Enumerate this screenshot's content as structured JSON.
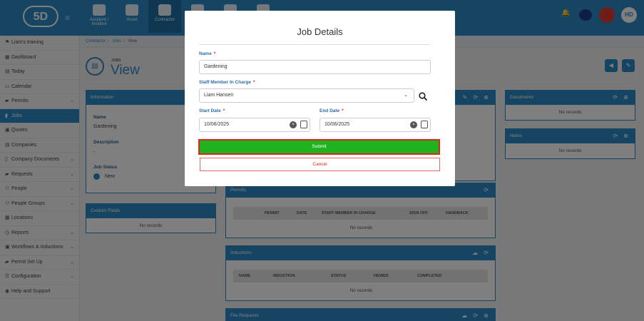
{
  "topbar": {
    "logo": "5D",
    "nav": [
      {
        "label": "Accident / Incident",
        "icon": "first-aid-kit-icon"
      },
      {
        "label": "Asset",
        "icon": "boxes-icon"
      },
      {
        "label": "Contractor",
        "icon": "hard-hat-icon"
      },
      {
        "label": "",
        "icon": "document-icon"
      },
      {
        "label": "",
        "icon": "person-icon"
      },
      {
        "label": "",
        "icon": "database-icon"
      }
    ],
    "user_initials": "HD"
  },
  "sidebar": {
    "items": [
      {
        "label": "Liam's training",
        "icon": "flag-icon",
        "chevron": false
      },
      {
        "label": "Dashboard",
        "icon": "dashboard-icon",
        "chevron": false
      },
      {
        "label": "Today",
        "icon": "calendar-today-icon",
        "chevron": false
      },
      {
        "label": "Calendar",
        "icon": "calendar-icon",
        "chevron": false
      },
      {
        "label": "Permits",
        "icon": "permit-icon",
        "chevron": true
      },
      {
        "label": "Jobs",
        "icon": "clipboard-icon",
        "chevron": false,
        "active": true
      },
      {
        "label": "Quotes",
        "icon": "quote-icon",
        "chevron": false
      },
      {
        "label": "Companies",
        "icon": "building-icon",
        "chevron": false
      },
      {
        "label": "Company Documents",
        "icon": "document-icon",
        "chevron": true
      },
      {
        "label": "Requests",
        "icon": "requests-icon",
        "chevron": true
      },
      {
        "label": "People",
        "icon": "people-icon",
        "chevron": true
      },
      {
        "label": "People Groups",
        "icon": "people-groups-icon",
        "chevron": true
      },
      {
        "label": "Locations",
        "icon": "locations-icon",
        "chevron": false
      },
      {
        "label": "Reports",
        "icon": "reports-icon",
        "chevron": true
      },
      {
        "label": "Workflows & Inductions",
        "icon": "workflow-icon",
        "chevron": true
      },
      {
        "label": "Permit Set Up",
        "icon": "permit-setup-icon",
        "chevron": true
      },
      {
        "label": "Configuration",
        "icon": "configuration-icon",
        "chevron": true
      },
      {
        "label": "Help and Support",
        "icon": "help-icon",
        "chevron": false
      }
    ]
  },
  "breadcrumb": {
    "items": [
      "Contractor",
      "Jobs",
      "View"
    ]
  },
  "page": {
    "small": "JOBS",
    "title": "View"
  },
  "info_panel": {
    "header": "Information",
    "fields": [
      {
        "label": "Name",
        "value": "Gardening"
      },
      {
        "label": "Description",
        "value": "-"
      },
      {
        "label": "Job Status",
        "value": "New"
      }
    ]
  },
  "custom_fields": {
    "header": "Custom Fields",
    "empty": "No records"
  },
  "documents": {
    "header": "Documents",
    "empty": "No records"
  },
  "notes": {
    "header": "Notes",
    "empty": "No records"
  },
  "permits": {
    "header": "Permits",
    "columns": [
      "PERMIT",
      "DATE",
      "STAFF MEMBER IN CHARGE",
      "SIGN OFF",
      "HANDBACK"
    ],
    "empty": "No records"
  },
  "inductions": {
    "header": "Inductions",
    "columns": [
      "NAME",
      "INDUCTION",
      "STATUS",
      "VIEWED",
      "COMPLETED"
    ],
    "empty": "No records"
  },
  "file_requests": {
    "header": "File Requests"
  },
  "modal": {
    "title": "Job Details",
    "name_label": "Name",
    "name_value": "Gardening",
    "staff_label": "Staff Member In Charge",
    "staff_value": "Liam Hansen",
    "start_label": "Start Date",
    "start_value": "10/06/2025",
    "end_label": "End Date",
    "end_value": "10/06/2025",
    "submit": "Submit",
    "cancel": "Cancel",
    "required_mark": "*"
  },
  "colors": {
    "primary": "#2c8ac7",
    "submit": "#1fb41f",
    "highlight": "#e0241f",
    "required": "#d9261c"
  }
}
